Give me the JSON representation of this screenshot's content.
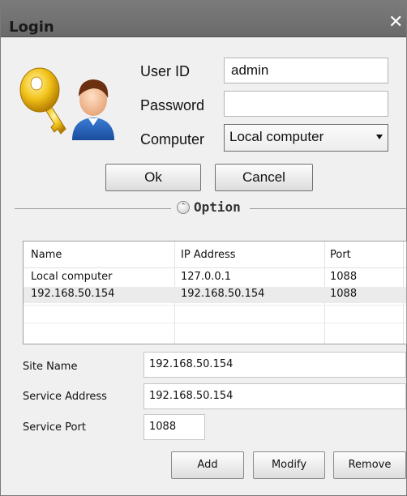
{
  "window": {
    "title": "Login",
    "close_glyph": "✕"
  },
  "icons": {
    "logo": "key-and-user-icon",
    "close": "close-icon",
    "dropdown": "dropdown-arrow-icon",
    "option_toggle": "collapse-up-icon"
  },
  "login": {
    "user_id_label": "User ID",
    "user_id_value": "admin",
    "password_label": "Password",
    "password_value": "",
    "computer_label": "Computer",
    "computer_selected": "Local computer",
    "ok_label": "Ok",
    "cancel_label": "Cancel"
  },
  "option": {
    "label": "Option",
    "toggle_glyph": "⌃"
  },
  "table": {
    "columns": [
      "Name",
      "IP Address",
      "Port"
    ],
    "rows": [
      [
        "Local computer",
        "127.0.0.1",
        "1088"
      ],
      [
        "192.168.50.154",
        "192.168.50.154",
        "1088"
      ]
    ]
  },
  "form": {
    "site_name_label": "Site Name",
    "site_name_value": "192.168.50.154",
    "service_address_label": "Service Address",
    "service_address_value": "192.168.50.154",
    "service_port_label": "Service Port",
    "service_port_value": "1088"
  },
  "actions": {
    "add_label": "Add",
    "modify_label": "Modify",
    "remove_label": "Remove"
  },
  "colors": {
    "titlebar": "#6f6f6f",
    "window_bg": "#f0f0f0",
    "alt_row": "#ebebeb"
  }
}
